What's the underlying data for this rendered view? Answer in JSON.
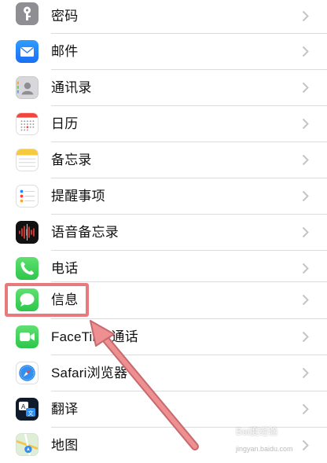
{
  "settings_list": {
    "items": [
      {
        "label": "密码",
        "icon": "key-icon"
      },
      {
        "label": "邮件",
        "icon": "mail-icon"
      },
      {
        "label": "通讯录",
        "icon": "contacts-icon"
      },
      {
        "label": "日历",
        "icon": "calendar-icon"
      },
      {
        "label": "备忘录",
        "icon": "notes-icon"
      },
      {
        "label": "提醒事项",
        "icon": "reminders-icon"
      },
      {
        "label": "语音备忘录",
        "icon": "voice-memos-icon"
      },
      {
        "label": "电话",
        "icon": "phone-icon"
      },
      {
        "label": "信息",
        "icon": "messages-icon"
      },
      {
        "label": "FaceTime通话",
        "icon": "facetime-icon"
      },
      {
        "label": "Safari浏览器",
        "icon": "safari-icon"
      },
      {
        "label": "翻译",
        "icon": "translate-icon"
      },
      {
        "label": "地图",
        "icon": "maps-icon"
      }
    ]
  },
  "annotation": {
    "highlight_color": "#e8797c",
    "highlighted_item": "信息"
  },
  "watermark": {
    "text": "Bai度经验",
    "url": "jingyan.baidu.com"
  },
  "colors": {
    "chevron": "#c4c4c7",
    "separator": "#dcdcdf"
  }
}
